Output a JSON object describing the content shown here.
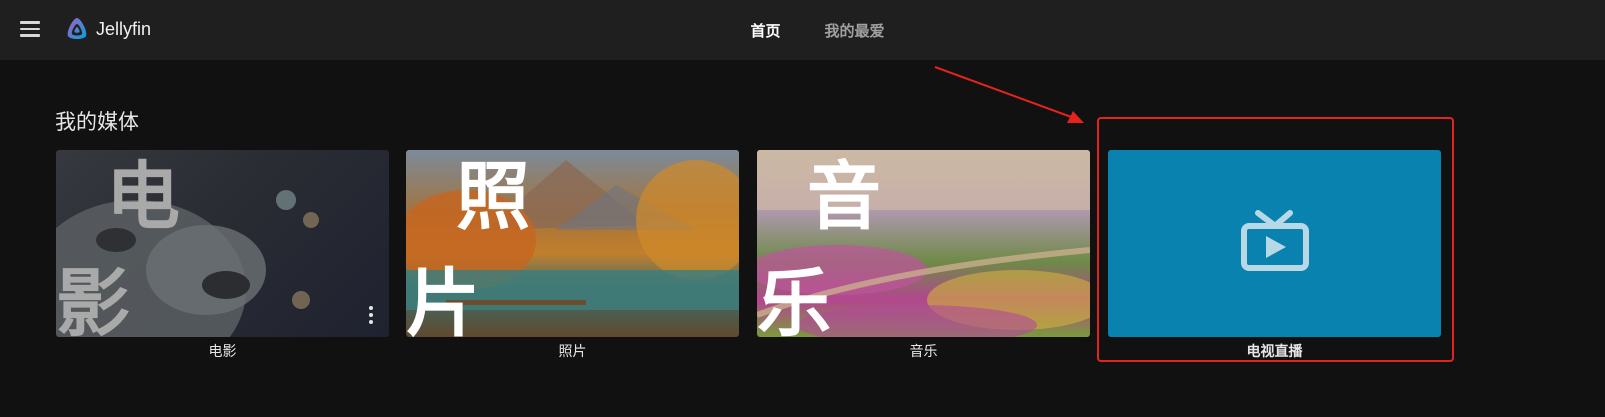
{
  "header": {
    "app_name": "Jellyfin",
    "icons": {
      "menu": "hamburger-menu-icon",
      "logo": "jellyfin-logo-icon"
    },
    "tabs": [
      {
        "label": "首页",
        "active": true
      },
      {
        "label": "我的最爱",
        "active": false
      }
    ]
  },
  "section": {
    "title": "我的媒体",
    "libraries": [
      {
        "label": "电影",
        "art_text": "电 影"
      },
      {
        "label": "照片",
        "art_text": "照 片"
      },
      {
        "label": "音乐",
        "art_text": "音 乐"
      },
      {
        "label": "电视直播",
        "icon": "live-tv-icon"
      }
    ]
  },
  "annotation": {
    "highlight_color": "#e2241c"
  },
  "colors": {
    "background": "#111111",
    "header": "#1f1f1f",
    "live_tv_card": "#0a82b0"
  }
}
